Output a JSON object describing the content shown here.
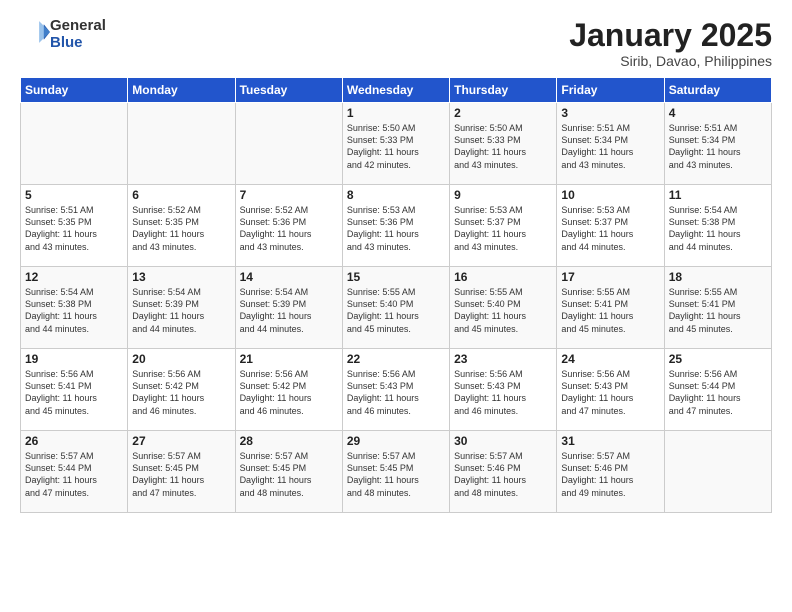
{
  "header": {
    "logo_line1": "General",
    "logo_line2": "Blue",
    "month": "January 2025",
    "location": "Sirib, Davao, Philippines"
  },
  "weekdays": [
    "Sunday",
    "Monday",
    "Tuesday",
    "Wednesday",
    "Thursday",
    "Friday",
    "Saturday"
  ],
  "weeks": [
    [
      {
        "day": "",
        "info": ""
      },
      {
        "day": "",
        "info": ""
      },
      {
        "day": "",
        "info": ""
      },
      {
        "day": "1",
        "info": "Sunrise: 5:50 AM\nSunset: 5:33 PM\nDaylight: 11 hours\nand 42 minutes."
      },
      {
        "day": "2",
        "info": "Sunrise: 5:50 AM\nSunset: 5:33 PM\nDaylight: 11 hours\nand 43 minutes."
      },
      {
        "day": "3",
        "info": "Sunrise: 5:51 AM\nSunset: 5:34 PM\nDaylight: 11 hours\nand 43 minutes."
      },
      {
        "day": "4",
        "info": "Sunrise: 5:51 AM\nSunset: 5:34 PM\nDaylight: 11 hours\nand 43 minutes."
      }
    ],
    [
      {
        "day": "5",
        "info": "Sunrise: 5:51 AM\nSunset: 5:35 PM\nDaylight: 11 hours\nand 43 minutes."
      },
      {
        "day": "6",
        "info": "Sunrise: 5:52 AM\nSunset: 5:35 PM\nDaylight: 11 hours\nand 43 minutes."
      },
      {
        "day": "7",
        "info": "Sunrise: 5:52 AM\nSunset: 5:36 PM\nDaylight: 11 hours\nand 43 minutes."
      },
      {
        "day": "8",
        "info": "Sunrise: 5:53 AM\nSunset: 5:36 PM\nDaylight: 11 hours\nand 43 minutes."
      },
      {
        "day": "9",
        "info": "Sunrise: 5:53 AM\nSunset: 5:37 PM\nDaylight: 11 hours\nand 43 minutes."
      },
      {
        "day": "10",
        "info": "Sunrise: 5:53 AM\nSunset: 5:37 PM\nDaylight: 11 hours\nand 44 minutes."
      },
      {
        "day": "11",
        "info": "Sunrise: 5:54 AM\nSunset: 5:38 PM\nDaylight: 11 hours\nand 44 minutes."
      }
    ],
    [
      {
        "day": "12",
        "info": "Sunrise: 5:54 AM\nSunset: 5:38 PM\nDaylight: 11 hours\nand 44 minutes."
      },
      {
        "day": "13",
        "info": "Sunrise: 5:54 AM\nSunset: 5:39 PM\nDaylight: 11 hours\nand 44 minutes."
      },
      {
        "day": "14",
        "info": "Sunrise: 5:54 AM\nSunset: 5:39 PM\nDaylight: 11 hours\nand 44 minutes."
      },
      {
        "day": "15",
        "info": "Sunrise: 5:55 AM\nSunset: 5:40 PM\nDaylight: 11 hours\nand 45 minutes."
      },
      {
        "day": "16",
        "info": "Sunrise: 5:55 AM\nSunset: 5:40 PM\nDaylight: 11 hours\nand 45 minutes."
      },
      {
        "day": "17",
        "info": "Sunrise: 5:55 AM\nSunset: 5:41 PM\nDaylight: 11 hours\nand 45 minutes."
      },
      {
        "day": "18",
        "info": "Sunrise: 5:55 AM\nSunset: 5:41 PM\nDaylight: 11 hours\nand 45 minutes."
      }
    ],
    [
      {
        "day": "19",
        "info": "Sunrise: 5:56 AM\nSunset: 5:41 PM\nDaylight: 11 hours\nand 45 minutes."
      },
      {
        "day": "20",
        "info": "Sunrise: 5:56 AM\nSunset: 5:42 PM\nDaylight: 11 hours\nand 46 minutes."
      },
      {
        "day": "21",
        "info": "Sunrise: 5:56 AM\nSunset: 5:42 PM\nDaylight: 11 hours\nand 46 minutes."
      },
      {
        "day": "22",
        "info": "Sunrise: 5:56 AM\nSunset: 5:43 PM\nDaylight: 11 hours\nand 46 minutes."
      },
      {
        "day": "23",
        "info": "Sunrise: 5:56 AM\nSunset: 5:43 PM\nDaylight: 11 hours\nand 46 minutes."
      },
      {
        "day": "24",
        "info": "Sunrise: 5:56 AM\nSunset: 5:43 PM\nDaylight: 11 hours\nand 47 minutes."
      },
      {
        "day": "25",
        "info": "Sunrise: 5:56 AM\nSunset: 5:44 PM\nDaylight: 11 hours\nand 47 minutes."
      }
    ],
    [
      {
        "day": "26",
        "info": "Sunrise: 5:57 AM\nSunset: 5:44 PM\nDaylight: 11 hours\nand 47 minutes."
      },
      {
        "day": "27",
        "info": "Sunrise: 5:57 AM\nSunset: 5:45 PM\nDaylight: 11 hours\nand 47 minutes."
      },
      {
        "day": "28",
        "info": "Sunrise: 5:57 AM\nSunset: 5:45 PM\nDaylight: 11 hours\nand 48 minutes."
      },
      {
        "day": "29",
        "info": "Sunrise: 5:57 AM\nSunset: 5:45 PM\nDaylight: 11 hours\nand 48 minutes."
      },
      {
        "day": "30",
        "info": "Sunrise: 5:57 AM\nSunset: 5:46 PM\nDaylight: 11 hours\nand 48 minutes."
      },
      {
        "day": "31",
        "info": "Sunrise: 5:57 AM\nSunset: 5:46 PM\nDaylight: 11 hours\nand 49 minutes."
      },
      {
        "day": "",
        "info": ""
      }
    ]
  ]
}
